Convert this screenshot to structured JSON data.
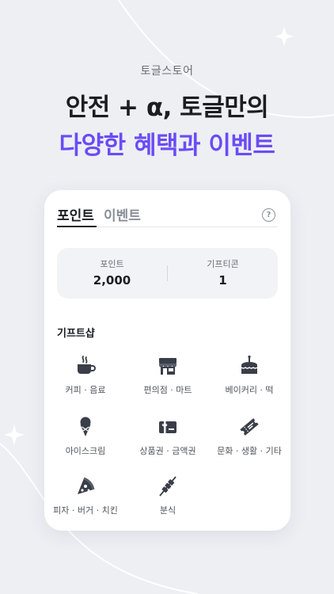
{
  "header": {
    "eyebrow": "토글스토어",
    "line1": "안전 + α, 토글만의",
    "line2": "다양한 혜택과 이벤트"
  },
  "colors": {
    "accent": "#6a4cf5",
    "icon": "#3a3e48",
    "background": "#eeeff3"
  },
  "tabs": [
    {
      "label": "포인트",
      "active": true
    },
    {
      "label": "이벤트",
      "active": false
    }
  ],
  "help": {
    "icon": "question-circle-icon",
    "symbol": "?"
  },
  "summary": {
    "points": {
      "label": "포인트",
      "value": "2,000"
    },
    "giftcons": {
      "label": "기프티콘",
      "value": "1"
    }
  },
  "gift_shop": {
    "title": "기프트샵",
    "categories": [
      {
        "label": "커피 · 음료",
        "icon": "coffee-cup-icon"
      },
      {
        "label": "편의점 · 마트",
        "icon": "store-icon"
      },
      {
        "label": "베이커리 · 떡",
        "icon": "cake-icon"
      },
      {
        "label": "아이스크림",
        "icon": "ice-cream-icon"
      },
      {
        "label": "상품권 · 금액권",
        "icon": "gift-card-icon"
      },
      {
        "label": "문화 · 생활 · 기타",
        "icon": "ticket-icon"
      },
      {
        "label": "피자 · 버거 · 치킨",
        "icon": "pizza-icon"
      },
      {
        "label": "분식",
        "icon": "skewer-icon"
      }
    ]
  }
}
